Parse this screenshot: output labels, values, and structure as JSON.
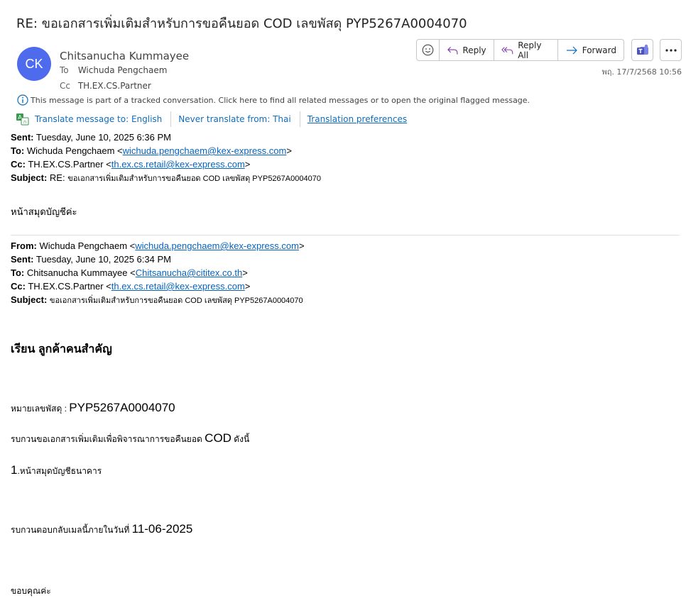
{
  "email": {
    "subject": "RE: ขอเอกสารเพิ่มเติมสำหรับการขอคืนยอด COD เลขพัสดุ PYP5267A0004070",
    "avatar_initials": "CK",
    "sender": "Chitsanucha Kummayee",
    "to_label": "To",
    "to": "Wichuda Pengchaem",
    "cc_label": "Cc",
    "cc": "TH.EX.CS.Partner",
    "date": "พฤ. 17/7/2568 10:56",
    "avatar_color": "#4f6bed"
  },
  "toolbar": {
    "emoji_icon": "emoji-icon",
    "reply": "Reply",
    "reply_all": "Reply All",
    "forward": "Forward",
    "teams_icon": "teams-icon",
    "more_icon": "more-icon"
  },
  "infobar": {
    "text": "This message is part of a tracked conversation. Click here to find all related messages or to open the original flagged message."
  },
  "translate": {
    "translate_to": "Translate message to: English",
    "never_translate": "Never translate from: Thai",
    "preferences": "Translation preferences"
  },
  "header1": {
    "sent_label": "Sent:",
    "sent": "Tuesday, June 10, 2025 6:36 PM",
    "to_label": "To:",
    "to_name": "Wichuda Pengchaem <",
    "to_email": "wichuda.pengchaem@kex-express.com",
    "to_end": ">",
    "cc_label": "Cc:",
    "cc_name": "TH.EX.CS.Partner <",
    "cc_email": "th.ex.cs.retail@kex-express.com",
    "cc_end": ">",
    "subject_label": "Subject:",
    "subject_pre": "RE: ",
    "subject_thai": "ขอเอกสารเพิ่มเติมสำหรับการขอคืนยอด COD เลขพัสดุ PYP5267A0004070"
  },
  "reply_text": "หน้าสมุดบัญชีค่ะ",
  "header2": {
    "from_label": "From:",
    "from_name": "Wichuda Pengchaem <",
    "from_email": "wichuda.pengchaem@kex-express.com",
    "from_end": ">",
    "sent_label": "Sent:",
    "sent": "Tuesday, June 10, 2025 6:34 PM",
    "to_label": "To:",
    "to_name": "Chitsanucha Kummayee <",
    "to_email": "Chitsanucha@cititex.co.th",
    "to_end": ">",
    "cc_label": "Cc:",
    "cc_name": "TH.EX.CS.Partner <",
    "cc_email": "th.ex.cs.retail@kex-express.com",
    "cc_end": ">",
    "subject_label": "Subject:",
    "subject_thai": "ขอเอกสารเพิ่มเติมสำหรับการขอคืนยอด COD เลขพัสดุ PYP5267A0004070"
  },
  "original": {
    "greeting": "เรียน ลูกค้าคนสำคัญ",
    "tracking_label": "หมายเลขพัสดุ : ",
    "tracking_no": "PYP5267A0004070",
    "request_pre": "รบกวนขอเอกสารเพิ่มเติมเพื่อพิจารณาการขอคืนยอด ",
    "request_cod": "COD",
    "request_post": " ดังนี้",
    "item_no": "1",
    "item_text": ".หน้าสมุดบัญชีธนาคาร",
    "reply_by_pre": "รบกวนตอบกลับเมลนี้ภายในวันที่ ",
    "reply_by_date": "11-06-2025",
    "thanks": "ขอบคุณค่ะ"
  }
}
